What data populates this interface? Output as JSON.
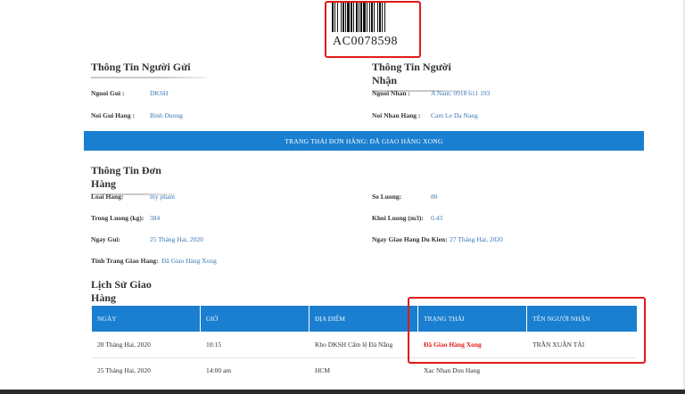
{
  "barcode": {
    "code": "AC0078598"
  },
  "sender": {
    "heading": "Thông Tin Người Gửi",
    "name_label": "Nguoi Gui :",
    "name_value": "DKSH",
    "place_label": "Noi Gui Hang :",
    "place_value": "Binh Duong"
  },
  "receiver": {
    "heading": "Thông Tin Người Nhận",
    "name_label": "Nguoi Nhan :",
    "name_value": "A Nam: 0918 611 193",
    "place_label": "Noi Nhan Hang :",
    "place_value": "Cam Le Da Nang"
  },
  "status_banner": "TRẠNG THÁI ĐƠN HÀNG: ĐÃ GIAO HÀNG XONG",
  "order": {
    "heading": "Thông Tin Đơn Hàng",
    "type_label": "Loai Hang:",
    "type_value": "my pham",
    "qty_label": "So Luong:",
    "qty_value": "80",
    "weight_label": "Trong Luong (kg):",
    "weight_value": "384",
    "volume_label": "Khoi Luong (m3):",
    "volume_value": "0.43",
    "send_date_label": "Ngay Gui:",
    "send_date_value": "25 Tháng Hai, 2020",
    "eta_label": "Ngay Giao Hang Du Kien:",
    "eta_value": "27 Tháng Hai, 2020",
    "delivery_status_label": "Tinh Trang Giao Hang:",
    "delivery_status_value": "Đã Giao Hàng Xong"
  },
  "history": {
    "heading": "Lịch Sử Giao Hàng",
    "columns": [
      "NGÀY",
      "GIỜ",
      "ĐỊA ĐIỂM",
      "TRẠNG THÁI",
      "TÊN NGƯỜI NHẬN"
    ],
    "rows": [
      {
        "date": "28 Tháng Hai, 2020",
        "time": "10:15",
        "location": "Kho DKSH Cẩm lệ Đà Nẵng",
        "status": "Đã Giao Hàng Xong",
        "receiver": "TRẦN XUÂN TÀI"
      },
      {
        "date": "25 Tháng Hai, 2020",
        "time": "14:00 am",
        "location": "HCM",
        "status": "Xac Nhan Don Hang",
        "receiver": ""
      }
    ]
  },
  "colors": {
    "accent_blue": "#1a7fd0",
    "value_blue": "#3a78b5",
    "highlight_red": "#e11a1a"
  }
}
